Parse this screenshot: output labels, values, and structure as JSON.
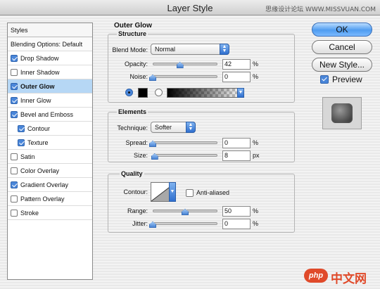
{
  "window": {
    "title": "Layer Style",
    "watermark_text": "思缘设计论坛 WWW.MISSVUAN.COM"
  },
  "styles_list": {
    "header": "Styles",
    "items": [
      {
        "label": "Blending Options: Default",
        "type": "plain",
        "checked": null
      },
      {
        "label": "Drop Shadow",
        "type": "check",
        "checked": true
      },
      {
        "label": "Inner Shadow",
        "type": "check",
        "checked": false
      },
      {
        "label": "Outer Glow",
        "type": "check",
        "checked": true,
        "selected": true
      },
      {
        "label": "Inner Glow",
        "type": "check",
        "checked": true
      },
      {
        "label": "Bevel and Emboss",
        "type": "check",
        "checked": true
      },
      {
        "label": "Contour",
        "type": "sub",
        "checked": true
      },
      {
        "label": "Texture",
        "type": "sub",
        "checked": true
      },
      {
        "label": "Satin",
        "type": "check",
        "checked": false
      },
      {
        "label": "Color Overlay",
        "type": "check",
        "checked": false
      },
      {
        "label": "Gradient Overlay",
        "type": "check",
        "checked": true
      },
      {
        "label": "Pattern Overlay",
        "type": "check",
        "checked": false
      },
      {
        "label": "Stroke",
        "type": "check",
        "checked": false
      }
    ]
  },
  "outer_glow": {
    "title": "Outer Glow",
    "structure": {
      "title": "Structure",
      "blend_mode_label": "Blend Mode:",
      "blend_mode_value": "Normal",
      "opacity_label": "Opacity:",
      "opacity_value": "42",
      "opacity_unit": "%",
      "opacity_fraction": 0.42,
      "noise_label": "Noise:",
      "noise_value": "0",
      "noise_unit": "%",
      "noise_fraction": 0.0,
      "glow_color": "#000000"
    },
    "elements": {
      "title": "Elements",
      "technique_label": "Technique:",
      "technique_value": "Softer",
      "spread_label": "Spread:",
      "spread_value": "0",
      "spread_unit": "%",
      "spread_fraction": 0.0,
      "size_label": "Size:",
      "size_value": "8",
      "size_unit": "px",
      "size_fraction": 0.03
    },
    "quality": {
      "title": "Quality",
      "contour_label": "Contour:",
      "anti_aliased_label": "Anti-aliased",
      "anti_aliased": false,
      "range_label": "Range:",
      "range_value": "50",
      "range_unit": "%",
      "range_fraction": 0.5,
      "jitter_label": "Jitter:",
      "jitter_value": "0",
      "jitter_unit": "%",
      "jitter_fraction": 0.0
    }
  },
  "buttons": {
    "ok": "OK",
    "cancel": "Cancel",
    "new_style": "New Style..."
  },
  "preview": {
    "label": "Preview",
    "checked": true
  },
  "watermark_logo": {
    "badge": "php",
    "text": "中文网"
  },
  "colors": {
    "accent": "#4a86d9",
    "selected_row": "#b6d7f5"
  }
}
